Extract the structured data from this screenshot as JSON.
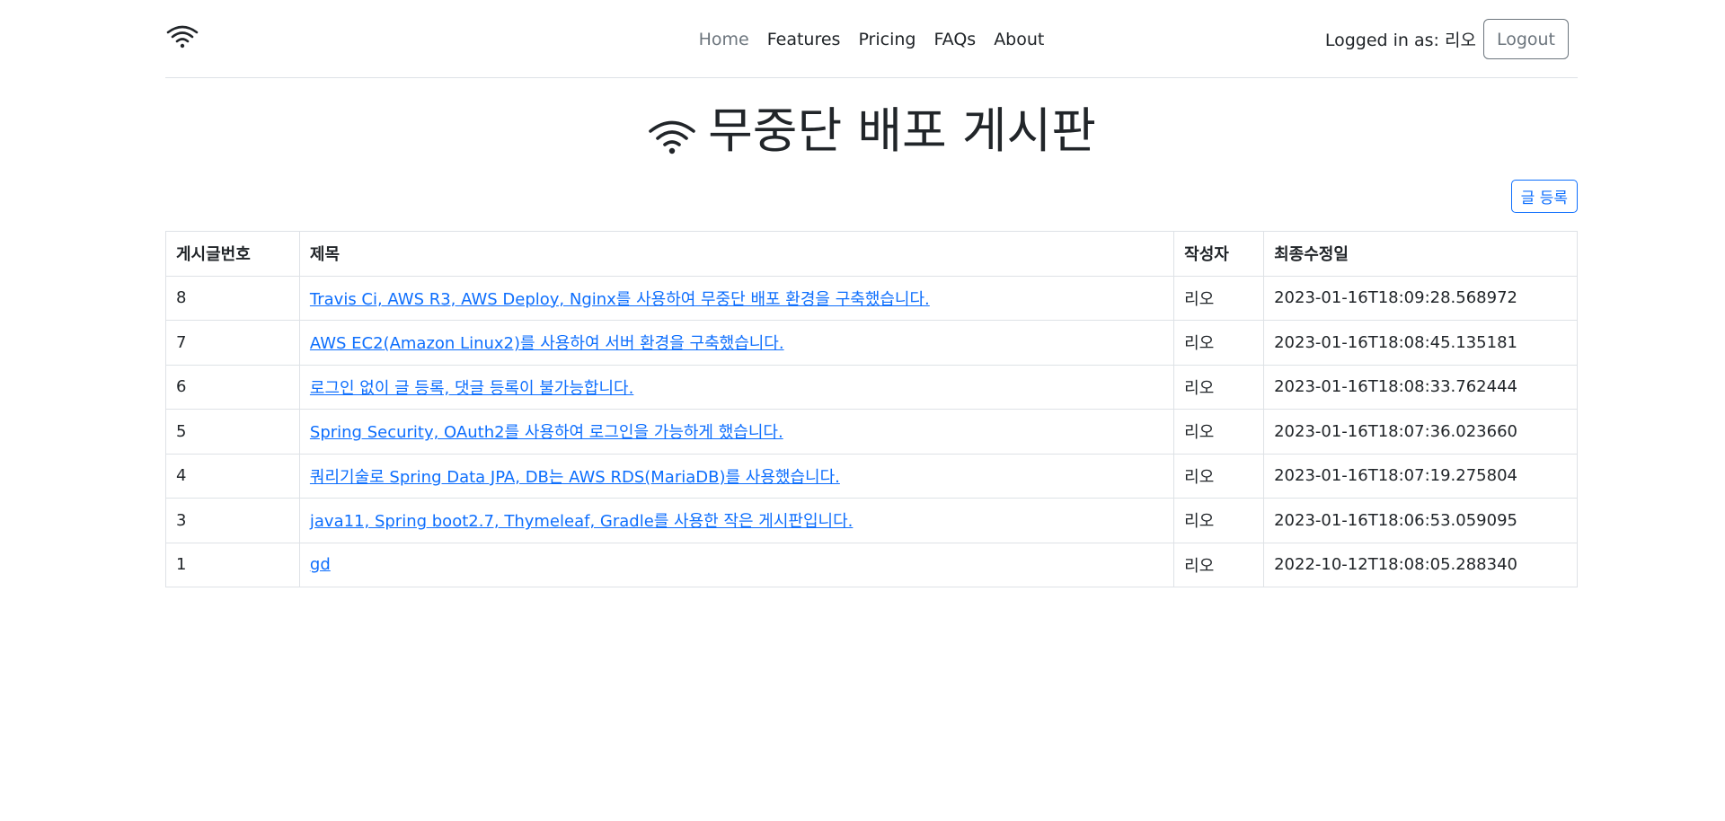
{
  "header": {
    "logo_icon": "wifi-icon",
    "nav": [
      {
        "label": "Home",
        "active": true
      },
      {
        "label": "Features"
      },
      {
        "label": "Pricing"
      },
      {
        "label": "FAQs"
      },
      {
        "label": "About"
      }
    ],
    "user": {
      "prefix": "Logged in as:",
      "name": "리오"
    },
    "logout_label": "Logout"
  },
  "page_title": "무중단 배포 게시판",
  "add_post_label": "글 등록",
  "colors": {
    "link": "#0d6efd",
    "muted": "#6c757d",
    "border": "#dee2e6"
  },
  "table": {
    "headers": [
      "게시글번호",
      "제목",
      "작성자",
      "최종수정일"
    ],
    "rows": [
      {
        "id": "8",
        "title": "Travis Ci, AWS R3, AWS Deploy, Nginx를 사용하여 무중단 배포 환경을 구축했습니다.",
        "author": "리오",
        "modified": "2023-01-16T18:09:28.568972"
      },
      {
        "id": "7",
        "title": "AWS EC2(Amazon Linux2)를 사용하여 서버 환경을 구축했습니다.",
        "author": "리오",
        "modified": "2023-01-16T18:08:45.135181"
      },
      {
        "id": "6",
        "title": "로그인 없이 글 등록, 댓글 등록이 불가능합니다.",
        "author": "리오",
        "modified": "2023-01-16T18:08:33.762444"
      },
      {
        "id": "5",
        "title": "Spring Security, OAuth2를 사용하여 로그인을 가능하게 했습니다.",
        "author": "리오",
        "modified": "2023-01-16T18:07:36.023660"
      },
      {
        "id": "4",
        "title": "쿼리기술로 Spring Data JPA, DB는 AWS RDS(MariaDB)를 사용했습니다.",
        "author": "리오",
        "modified": "2023-01-16T18:07:19.275804"
      },
      {
        "id": "3",
        "title": "java11, Spring boot2.7, Thymeleaf, Gradle를 사용한 작은 게시판입니다.",
        "author": "리오",
        "modified": "2023-01-16T18:06:53.059095"
      },
      {
        "id": "1",
        "title": "gd",
        "author": "리오",
        "modified": "2022-10-12T18:08:05.288340"
      }
    ]
  }
}
